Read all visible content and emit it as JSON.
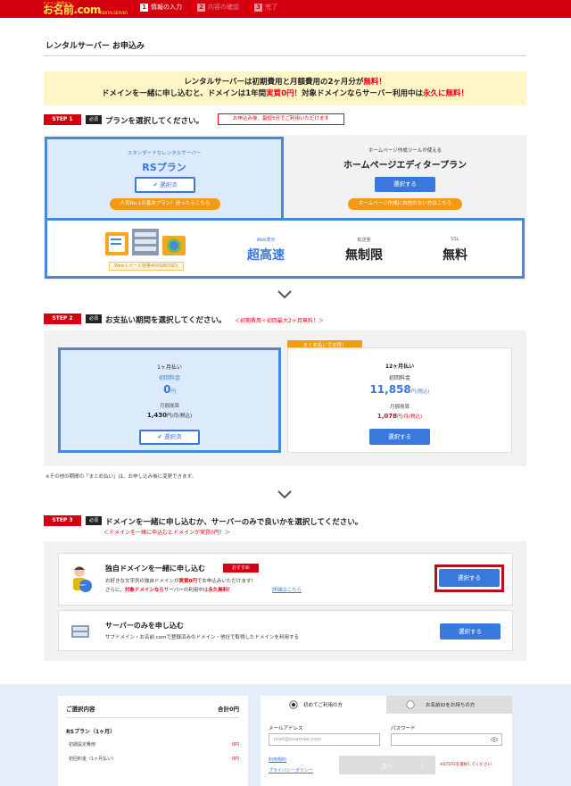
{
  "header": {
    "logo_small": "ドメイン取得なら",
    "logo": "お名前.com",
    "logo_sub": "RENTALSERVER",
    "steps": [
      {
        "num": "1",
        "label": "情報の入力"
      },
      {
        "num": "2",
        "label": "内容の確認"
      },
      {
        "num": "3",
        "label": "完了"
      }
    ]
  },
  "page_title": "レンタルサーバー お申込み",
  "banner": {
    "l1_a": "レンタルサーバーは初期費用と月額費用の2ヶ月分が",
    "l1_b": "無料！",
    "l2_a": "ドメインを一緒に申し込むと、ドメインは1年間",
    "l2_b": "実質0円！",
    "l2_c": "対象ドメインならサーバー利用中は",
    "l2_d": "永久に無料！"
  },
  "step1": {
    "badge": "STEP 1",
    "required": "必須",
    "title": "プランを選択してください。",
    "note": "お申込み後、最短5分でご利用いただけます",
    "plan_rs": {
      "caption": "スタンダードなレンタルサーバー",
      "name": "RSプラン",
      "button": "選択済",
      "pill": "人気No.1の基本プラン！迷ったらこちら"
    },
    "plan_editor": {
      "caption": "ホームページ作成ツールが使える",
      "name": "ホームページエディタープラン",
      "button": "選択する",
      "pill": "ホームページ作成に自信のない方はこちら"
    },
    "capacity": "Web＋メール容量400GB(SSD)",
    "features": [
      {
        "label": "Web表示",
        "value": "超高速"
      },
      {
        "label": "転送量",
        "value": "無制限"
      },
      {
        "label": "SSL",
        "value": "無料"
      }
    ]
  },
  "step2": {
    "badge": "STEP 2",
    "required": "必須",
    "title": "お支払い期間を選択してください。",
    "subnote": "＜初期費用＋初回最大2ヶ月無料！＞",
    "option1": {
      "period": "1ヶ月払い",
      "initial_label": "初回料金",
      "initial_amount": "0",
      "initial_unit": "円",
      "monthly_label": "月額換算",
      "monthly_amount": "1,430",
      "monthly_unit": "円/月(税込)",
      "button": "選択済"
    },
    "option2": {
      "tag": "まとめ払いでお得！",
      "period": "12ヶ月払い",
      "initial_label": "初回料金",
      "initial_amount": "11,858",
      "initial_unit": "円(税込)",
      "monthly_label": "月額換算",
      "monthly_amount": "1,078",
      "monthly_unit": "円/月(税込)",
      "button": "選択する"
    },
    "footnote": "※その他の期間の「まとめ払い」は、お申し込み後に変更できます。"
  },
  "step3": {
    "badge": "STEP 3",
    "required": "必須",
    "title": "ドメインを一緒に申し込むか、サーバーのみで良いかを選択してください。",
    "subnote": "＜ドメインを一緒に申込むとドメインが実質0円！＞",
    "option_domain": {
      "title": "独自ドメインを一緒に申し込む",
      "tag": "おすすめ",
      "desc1_a": "お好きな文字列の独自ドメインが",
      "desc1_b": "実質0円",
      "desc1_c": "でお申込みいただけます！",
      "desc2_a": "さらに、",
      "desc2_b": "対象ドメインなら",
      "desc2_c": "サーバーの利用中は",
      "desc2_d": "永久無料！",
      "link": "詳細はこちら",
      "button": "選択する",
      "icon_text": ".com"
    },
    "option_server": {
      "title": "サーバーのみを申し込む",
      "desc": "サブドメイン・お名前.comで登録済みのドメイン・他社で取得したドメインを利用する",
      "button": "選択する"
    }
  },
  "summary": {
    "title": "ご選択内容",
    "total_label": "合計",
    "total_value": "0円",
    "plan": "RSプラン（1ヶ月）",
    "rows": [
      {
        "label": "初期設定費用",
        "value": "0円"
      },
      {
        "label": "初回料金（1ヶ月払い）",
        "value": "0円"
      }
    ]
  },
  "login": {
    "tab_new": "初めてご利用の方",
    "tab_existing": "お名前IDをお持ちの方",
    "email_label": "メールアドレス",
    "email_placeholder": "mail@onamae.com",
    "password_label": "パスワード",
    "terms_link": "利用規約",
    "privacy_link": "プライバシーポリシー",
    "next_button": "次へ",
    "next_arrow": "〉",
    "warning": "※STEP3を選択してください"
  },
  "colors": {
    "brand_red": "#d40010",
    "accent_blue": "#3a78de",
    "orange": "#f39a12",
    "highlight": "#e60012"
  }
}
